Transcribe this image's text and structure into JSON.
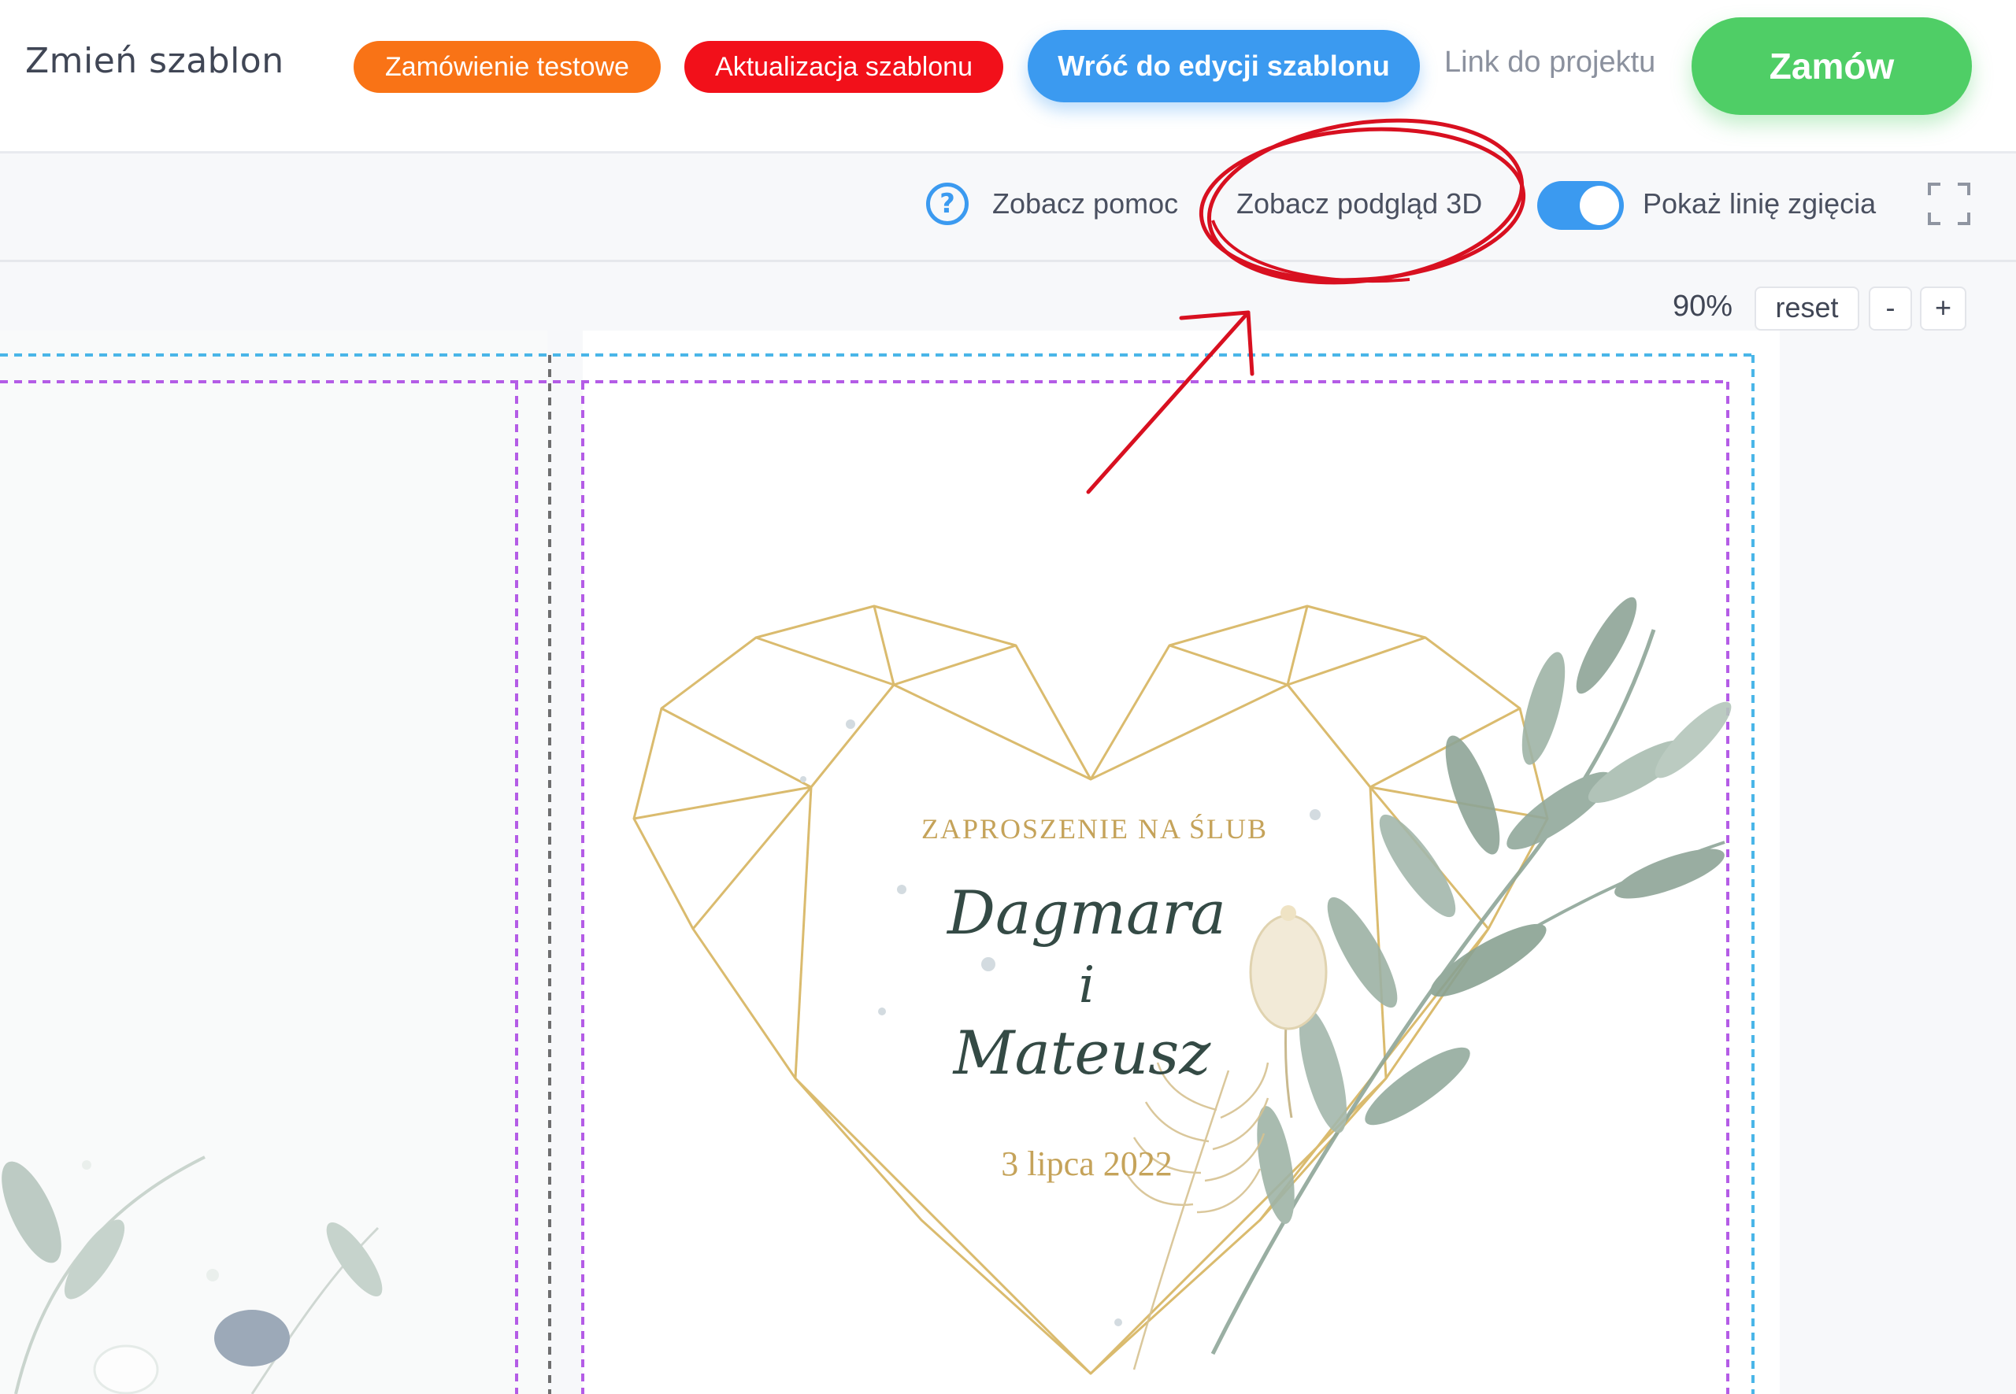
{
  "header": {
    "change_template": "Zmień szablon",
    "test_order": "Zamówienie testowe",
    "update_template": "Aktualizacja szablonu",
    "back_to_edit": "Wróć do edycji szablonu",
    "project_link": "Link do projektu",
    "order": "Zamów"
  },
  "toolbar": {
    "help_icon_glyph": "?",
    "help": "Zobacz pomoc",
    "preview_3d": "Zobacz podgląd 3D",
    "fold_line_toggle_on": true,
    "fold_line": "Pokaż linię zgięcia"
  },
  "zoom": {
    "level": "90%",
    "reset": "reset",
    "minus": "-",
    "plus": "+"
  },
  "invitation": {
    "heading": "ZAPROSZENIE NA ŚLUB",
    "name1": "Dagmara",
    "conjunction": "i",
    "name2": "Mateusz",
    "date": "3 lipca 2022"
  },
  "colors": {
    "accent_blue": "#3b9af0",
    "orange": "#f97316",
    "red": "#f2101a",
    "green": "#4fce66",
    "gold": "#c5a35a",
    "guide_purple": "#b45ce6",
    "guide_cyan": "#4ab6e8",
    "annotation_red": "#d81020"
  }
}
